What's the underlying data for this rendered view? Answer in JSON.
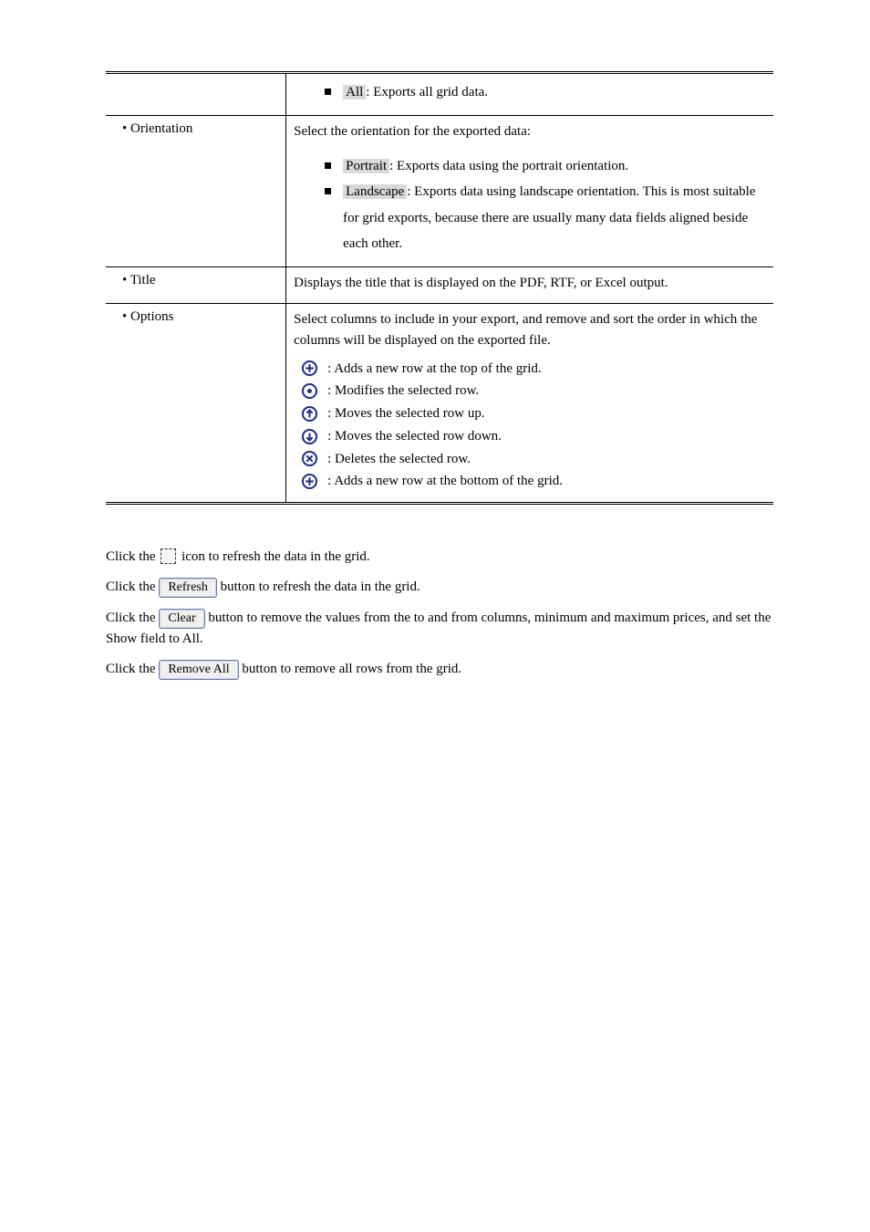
{
  "table": {
    "row0_shaded": "All",
    "row0_tail": ": Exports all grid data.",
    "row1_left": "Orientation",
    "row1_right_text": "Select the orientation for the exported data:",
    "row1_opt1_shaded": "Portrait",
    "row1_opt1_tail": ": Exports data using the portrait orientation.",
    "row1_opt2_shaded": "Landscape",
    "row1_opt2_tail": ": Exports data using landscape orientation. This is most suitable for grid exports, because there are usually many data fields aligned beside each other.",
    "row2_left": "Title",
    "row2_right": "Displays the title that is displayed on the PDF, RTF, or Excel output.",
    "row3_left": "Options",
    "row3_right_text": "Select columns to include in your export, and remove and sort the order in which the columns will be displayed on the exported file.",
    "icons": {
      "add_top": ": Adds a new row at the top of the grid.",
      "modify": ": Modifies the selected row.",
      "move_up": ": Moves the selected row up.",
      "move_down": ": Moves the selected row down.",
      "delete": ": Deletes the selected row.",
      "add_bottom": ": Adds a new row at the bottom of the grid."
    }
  },
  "btns": {
    "refresh_pre": "Click the ",
    "refresh_label": "Refresh",
    "refresh_post": " icon to refresh the data in the grid.",
    "refresh2_label": "Refresh",
    "refresh2_post": " button to refresh the data in the grid.",
    "clear_label": "Clear",
    "clear_post": " button to remove the values from the to and from columns, minimum and maximum prices, and set the Show field to All.",
    "removeall_label": "Remove All",
    "removeall_post": " button to remove all rows from the grid.",
    "click_pre": "Click the "
  }
}
